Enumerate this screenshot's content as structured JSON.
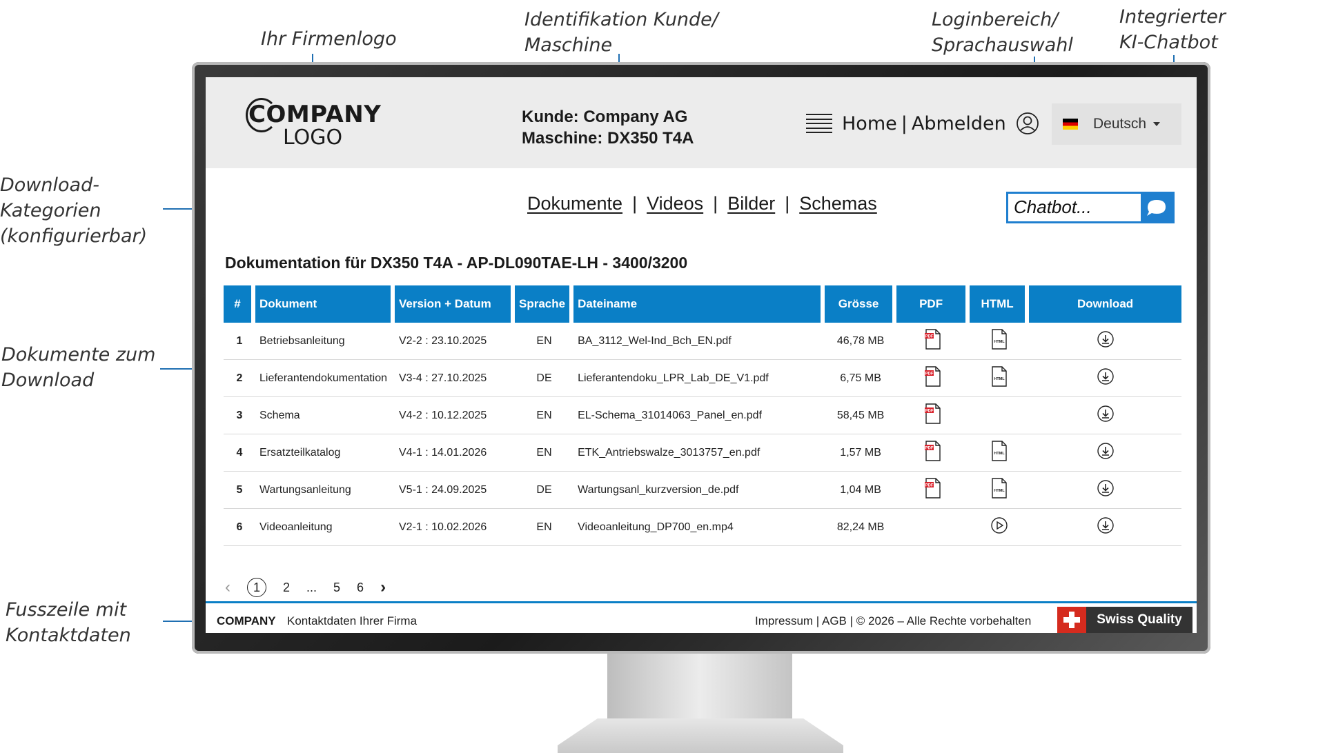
{
  "annotations": {
    "logo": "Ihr Firmenlogo",
    "identification": "Identifikation Kunde/\nMaschine",
    "login": "Loginbereich/\nSprachauswahl",
    "chatbot": "Integrierter\nKI-Chatbot",
    "categories": "Download-\nKategorien\n(konfigurierbar)",
    "documents": "Dokumente zum\nDownload",
    "footer": "Fusszeile mit\nKontaktdaten"
  },
  "header": {
    "logo_line1": "COMPANY",
    "logo_line2": "LOGO",
    "customer": "Kunde: Company AG",
    "machine": "Maschine: DX350 T4A",
    "nav_home": "Home",
    "nav_sep": "|",
    "nav_logout": "Abmelden",
    "language": "Deutsch"
  },
  "categories": [
    "Dokumente",
    "Videos",
    "Bilder",
    "Schemas"
  ],
  "chatbot": {
    "placeholder": "Chatbot..."
  },
  "doc_title": "Dokumentation für DX350 T4A - AP-DL090TAE-LH - 3400/3200",
  "table": {
    "columns": [
      "#",
      "Dokument",
      "Version + Datum",
      "Sprache",
      "Dateiname",
      "Grösse",
      "PDF",
      "HTML",
      "Download"
    ],
    "rows": [
      {
        "n": "1",
        "doc": "Betriebsanleitung",
        "version": "V2-2 : 23.10.2025",
        "lang": "EN",
        "file": "BA_3112_Wel-Ind_Bch_EN.pdf",
        "size": "46,78 MB",
        "pdf": true,
        "html": "html"
      },
      {
        "n": "2",
        "doc": "Lieferantendokumentation",
        "version": "V3-4 : 27.10.2025",
        "lang": "DE",
        "file": "Lieferantendoku_LPR_Lab_DE_V1.pdf",
        "size": "6,75 MB",
        "pdf": true,
        "html": "html"
      },
      {
        "n": "3",
        "doc": "Schema",
        "version": "V4-2 : 10.12.2025",
        "lang": "EN",
        "file": "EL-Schema_31014063_Panel_en.pdf",
        "size": "58,45 MB",
        "pdf": true,
        "html": "none"
      },
      {
        "n": "4",
        "doc": "Ersatzteilkatalog",
        "version": "V4-1 : 14.01.2026",
        "lang": "EN",
        "file": "ETK_Antriebswalze_3013757_en.pdf",
        "size": "1,57 MB",
        "pdf": true,
        "html": "html"
      },
      {
        "n": "5",
        "doc": "Wartungsanleitung",
        "version": "V5-1 : 24.09.2025",
        "lang": "DE",
        "file": "Wartungsanl_kurzversion_de.pdf",
        "size": "1,04 MB",
        "pdf": true,
        "html": "html"
      },
      {
        "n": "6",
        "doc": "Videoanleitung",
        "version": "V2-1 : 10.02.2026",
        "lang": "EN",
        "file": "Videoanleitung_DP700_en.mp4",
        "size": "82,24 MB",
        "pdf": false,
        "html": "play"
      }
    ]
  },
  "pager": {
    "prev": "‹",
    "current": "1",
    "p2": "2",
    "dots": "...",
    "p5": "5",
    "p6": "6",
    "next": "›"
  },
  "footer": {
    "company": "COMPANY",
    "contact": "Kontaktdaten Ihrer Firma",
    "links": "Impressum |  AGB  |  © 2026 – Alle Rechte vorbehalten",
    "badge": "Swiss Quality"
  },
  "colors": {
    "accent": "#0a7fc6",
    "pdf_red": "#d9232d",
    "swiss_red": "#d52b1e"
  }
}
